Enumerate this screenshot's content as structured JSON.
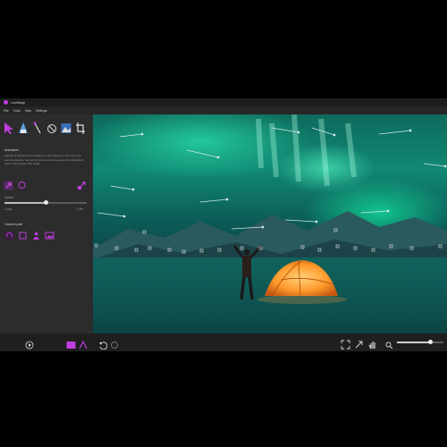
{
  "app": {
    "title": "LumiMage",
    "accent": "#c03de0"
  },
  "menu": {
    "items": [
      "File",
      "Tools",
      "Help",
      "Settings"
    ]
  },
  "panel": {
    "title": "Animation",
    "description": "Add life to still photos by drawing motion arrows on the parts you want to animate. Use anchor points to freeze areas that should not move, then preview the result.",
    "sliders": [
      {
        "label": "Speed",
        "value": "",
        "level": 0.5
      },
      {
        "label": "Loop",
        "value": "2.5s",
        "level": 0.0
      }
    ],
    "section_title": "Camera path",
    "tools": [
      "motion-arrow-tool",
      "anchor-tool",
      "selection-tool",
      "eraser-tool",
      "sky-tool",
      "crop-tool"
    ]
  },
  "status": {
    "zoom_label": "",
    "zoom_level": 0.72
  },
  "colors": {
    "panel": "#2c2c2c",
    "statusbar": "#1f1f1f",
    "accent": "#c03de0"
  }
}
